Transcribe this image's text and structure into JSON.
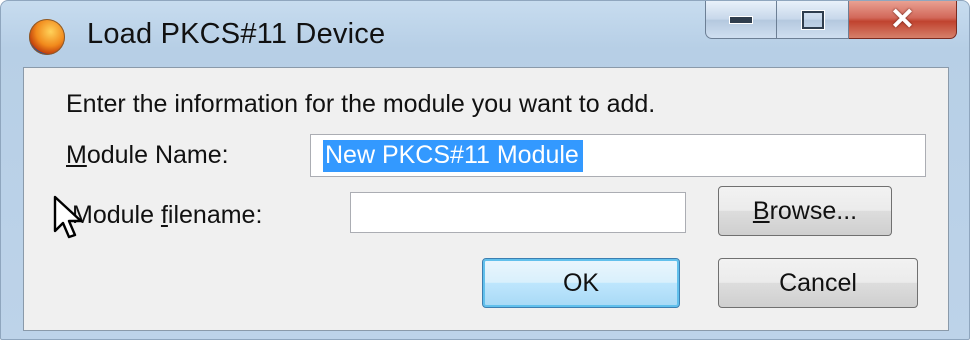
{
  "window": {
    "title": "Load PKCS#11 Device",
    "app_icon": "firefox-icon",
    "controls": {
      "minimize": "minimize-icon",
      "maximize": "maximize-icon",
      "close": "close-icon"
    }
  },
  "dialog": {
    "prompt": "Enter the information for the module you want to add.",
    "module_name": {
      "label_pre": "",
      "label_access": "M",
      "label_post": "odule Name:",
      "value": "New PKCS#11 Module",
      "selected": true
    },
    "module_filename": {
      "label_pre": "Module ",
      "label_access": "f",
      "label_post": "ilename:",
      "value": ""
    },
    "browse": {
      "label_access": "B",
      "label_post": "rowse..."
    },
    "ok_label": "OK",
    "cancel_label": "Cancel"
  },
  "colors": {
    "selection": "#3399ff",
    "titlebar": "#bdd3e9",
    "close_button": "#c0432f"
  }
}
